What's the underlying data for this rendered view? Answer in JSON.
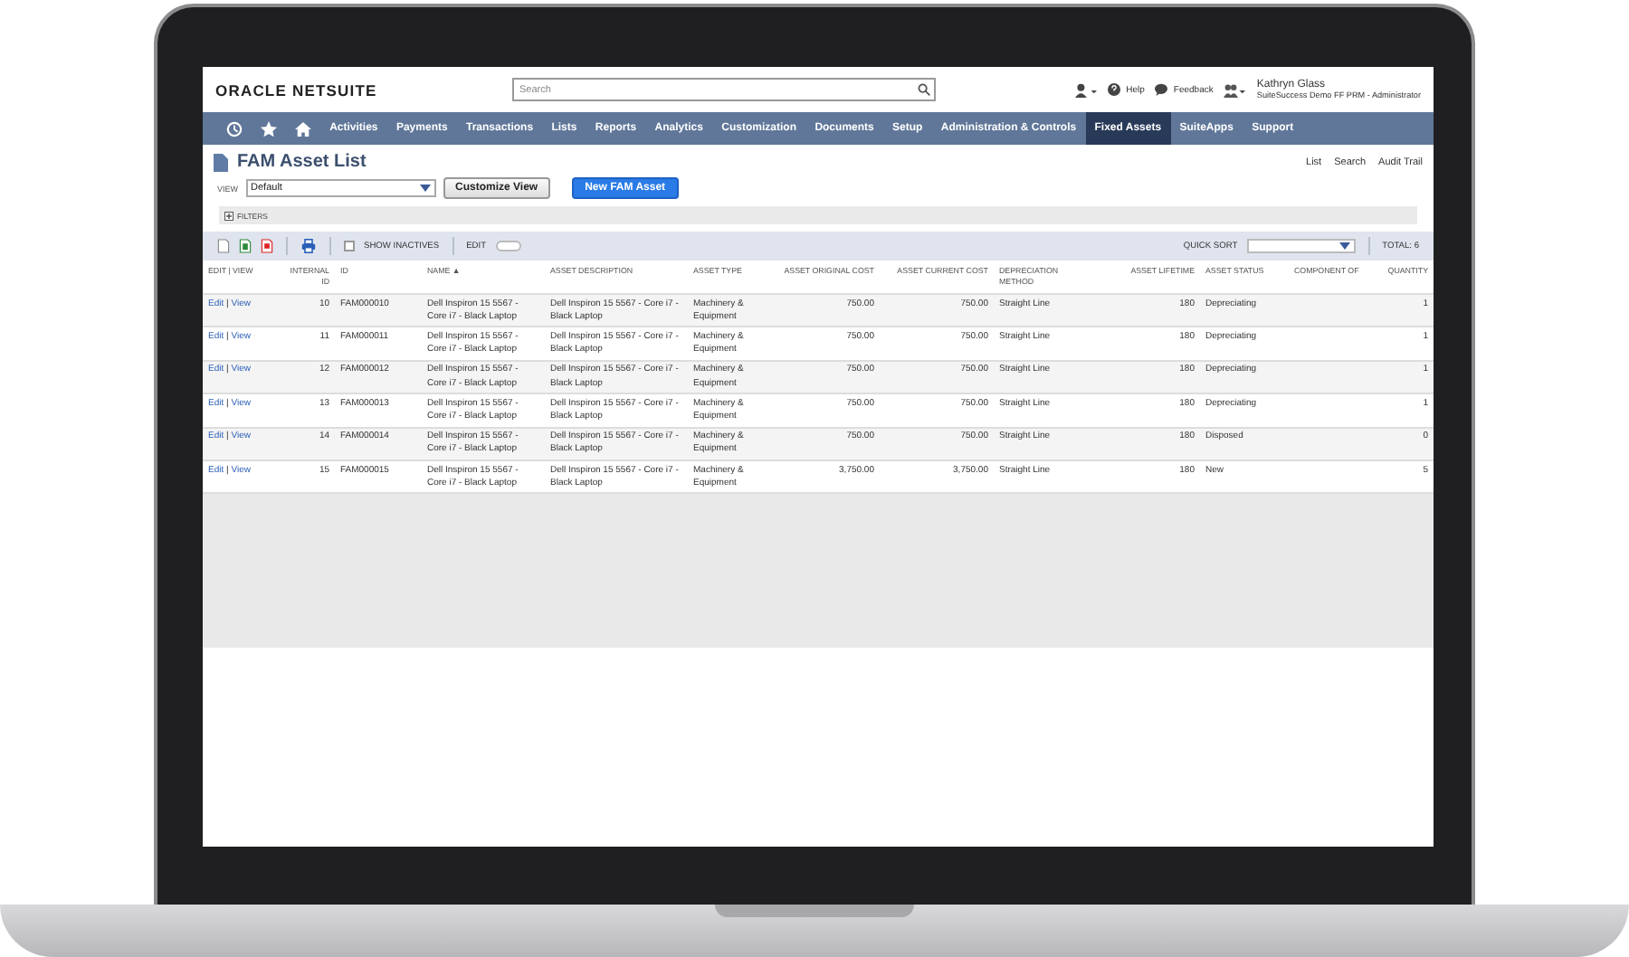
{
  "header": {
    "logo": "ORACLE NETSUITE",
    "search": {
      "placeholder": "Search"
    },
    "help": "Help",
    "feedback": "Feedback",
    "user_name": "Kathryn Glass",
    "user_role": "SuiteSuccess Demo FF PRM - Administrator"
  },
  "nav": [
    {
      "label": "Activities",
      "selected": false
    },
    {
      "label": "Payments",
      "selected": false
    },
    {
      "label": "Transactions",
      "selected": false
    },
    {
      "label": "Lists",
      "selected": false
    },
    {
      "label": "Reports",
      "selected": false
    },
    {
      "label": "Analytics",
      "selected": false
    },
    {
      "label": "Customization",
      "selected": false
    },
    {
      "label": "Documents",
      "selected": false
    },
    {
      "label": "Setup",
      "selected": false
    },
    {
      "label": "Administration & Controls",
      "selected": false
    },
    {
      "label": "Fixed Assets",
      "selected": true
    },
    {
      "label": "SuiteApps",
      "selected": false
    },
    {
      "label": "Support",
      "selected": false
    }
  ],
  "page": {
    "title": "FAM Asset List",
    "links": [
      "List",
      "Search",
      "Audit Trail"
    ],
    "view_label": "VIEW",
    "view_value": "Default",
    "buttons": [
      {
        "label": "Customize View",
        "kind": "secondary"
      },
      {
        "label": "New FAM Asset",
        "kind": "primary"
      }
    ],
    "filters": "FILTERS"
  },
  "toolbar": {
    "show_inactives": {
      "label": "SHOW INACTIVES",
      "checked": false
    },
    "edit": {
      "label": "EDIT",
      "on": false
    },
    "quick_sort": "QUICK SORT",
    "total": "TOTAL: 6"
  },
  "table": {
    "columns": [
      "EDIT | VIEW",
      "INTERNAL ID",
      "ID",
      "NAME ▲",
      "ASSET DESCRIPTION",
      "ASSET TYPE",
      "ASSET ORIGINAL COST",
      "ASSET CURRENT COST",
      "DEPRECIATION METHOD",
      "ASSET LIFETIME",
      "ASSET STATUS",
      "COMPONENT OF",
      "QUANTITY"
    ],
    "rows": [
      {
        "edit": "Edit",
        "separator": "|",
        "view": "View",
        "internal_id": "10",
        "id": "FAM000010",
        "name": "Dell Inspiron 15 5567 - Core i7 - Black Laptop",
        "description": "Dell Inspiron 15 5567 - Core i7 - Black Laptop",
        "type": "Machinery & Equipment",
        "original_cost": "750.00",
        "current_cost": "750.00",
        "method": "Straight Line",
        "lifetime": "180",
        "status": "Depreciating",
        "quantity": "1"
      },
      {
        "edit": "Edit",
        "separator": "|",
        "view": "View",
        "internal_id": "11",
        "id": "FAM000011",
        "name": "Dell Inspiron 15 5567 - Core i7 - Black Laptop",
        "description": "Dell Inspiron 15 5567 - Core i7 - Black Laptop",
        "type": "Machinery & Equipment",
        "original_cost": "750.00",
        "current_cost": "750.00",
        "method": "Straight Line",
        "lifetime": "180",
        "status": "Depreciating",
        "quantity": "1"
      },
      {
        "edit": "Edit",
        "separator": "|",
        "view": "View",
        "internal_id": "12",
        "id": "FAM000012",
        "name": "Dell Inspiron 15 5567 - Core i7 - Black Laptop",
        "description": "Dell Inspiron 15 5567 - Core i7 - Black Laptop",
        "type": "Machinery & Equipment",
        "original_cost": "750.00",
        "current_cost": "750.00",
        "method": "Straight Line",
        "lifetime": "180",
        "status": "Depreciating",
        "quantity": "1"
      },
      {
        "edit": "Edit",
        "separator": "|",
        "view": "View",
        "internal_id": "13",
        "id": "FAM000013",
        "name": "Dell Inspiron 15 5567 - Core i7 - Black Laptop",
        "description": "Dell Inspiron 15 5567 - Core i7 - Black Laptop",
        "type": "Machinery & Equipment",
        "original_cost": "750.00",
        "current_cost": "750.00",
        "method": "Straight Line",
        "lifetime": "180",
        "status": "Depreciating",
        "quantity": "1"
      },
      {
        "edit": "Edit",
        "separator": "|",
        "view": "View",
        "internal_id": "14",
        "id": "FAM000014",
        "name": "Dell Inspiron 15 5567 - Core i7 - Black Laptop",
        "description": "Dell Inspiron 15 5567 - Core i7 - Black Laptop",
        "type": "Machinery & Equipment",
        "original_cost": "750.00",
        "current_cost": "750.00",
        "method": "Straight Line",
        "lifetime": "180",
        "status": "Disposed",
        "quantity": "0"
      },
      {
        "edit": "Edit",
        "separator": "|",
        "view": "View",
        "internal_id": "15",
        "id": "FAM000015",
        "name": "Dell Inspiron 15 5567 - Core i7 - Black Laptop",
        "description": "Dell Inspiron 15 5567 - Core i7 - Black Laptop",
        "type": "Machinery & Equipment",
        "original_cost": "3,750.00",
        "current_cost": "3,750.00",
        "method": "Straight Line",
        "lifetime": "180",
        "status": "New",
        "quantity": "5"
      }
    ]
  }
}
